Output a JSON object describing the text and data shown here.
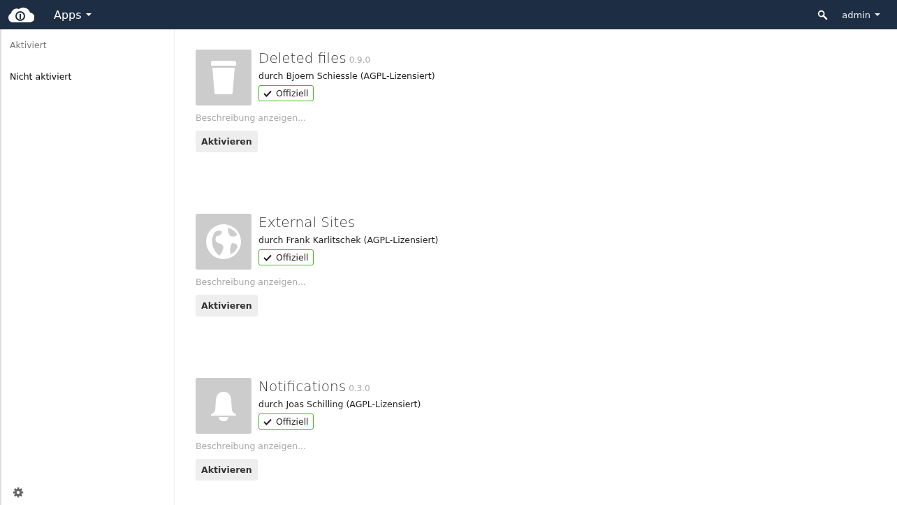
{
  "header": {
    "app_menu": "Apps",
    "user_menu": "admin"
  },
  "sidebar": {
    "items": [
      {
        "label": "Aktiviert",
        "selected": false
      },
      {
        "label": "Nicht aktiviert",
        "selected": true
      }
    ]
  },
  "apps": [
    {
      "kind": "trash",
      "name": "Deleted files",
      "version": "0.9.0",
      "author": "durch Bjoern Schiessle (AGPL-Lizensiert)",
      "badge": "Offiziell",
      "description_link": "Beschreibung anzeigen...",
      "button": "Aktivieren"
    },
    {
      "kind": "globe",
      "name": "External Sites",
      "author": "durch Frank Karlitschek (AGPL-Lizensiert)",
      "badge": "Offiziell",
      "description_link": "Beschreibung anzeigen...",
      "button": "Aktivieren"
    },
    {
      "kind": "bell",
      "name": "Notifications",
      "version": "0.3.0",
      "author": "durch Joas Schilling (AGPL-Lizensiert)",
      "badge": "Offiziell",
      "description_link": "Beschreibung anzeigen...",
      "button": "Aktivieren"
    }
  ]
}
